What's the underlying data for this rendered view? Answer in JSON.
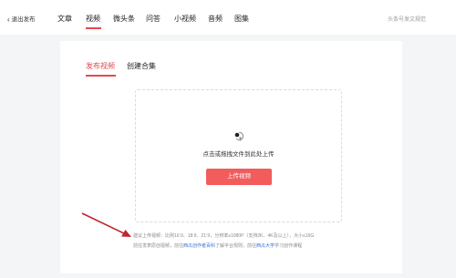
{
  "header": {
    "back_label": "退出发布",
    "tabs": [
      {
        "label": "文章"
      },
      {
        "label": "视频"
      },
      {
        "label": "微头条"
      },
      {
        "label": "问答"
      },
      {
        "label": "小视频"
      },
      {
        "label": "音频"
      },
      {
        "label": "图集"
      }
    ],
    "active_tab": "视频",
    "right_text": "头条号发文规范"
  },
  "card": {
    "subtabs": [
      {
        "label": "发布视频"
      },
      {
        "label": "创建合集"
      }
    ],
    "active_subtab": "发布视频",
    "upload": {
      "hint": "点击或拖拽文件到此处上传",
      "button_label": "上传视频"
    },
    "tips": {
      "line1": "建议上传视频：比例16:9、18:9、21:9，分辨率≥1080P（支持2K、4K及以上），大小≤16G",
      "line2_part1": "前往发表原创视频，前往",
      "line2_link1": "西瓜创作者百科",
      "line2_part2": "了解平台规则，前往",
      "line2_link2": "西瓜大学",
      "line2_part3": "学习创作课程"
    }
  },
  "colors": {
    "accent": "#e6494d",
    "button": "#f25c5c",
    "link": "#3a6fd8",
    "arrow": "#c0262b"
  }
}
